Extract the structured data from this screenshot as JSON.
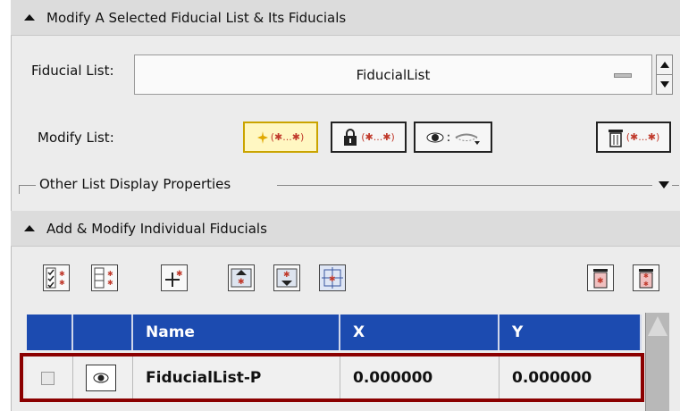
{
  "section1": {
    "title": "Modify A Selected Fiducial List & Its Fiducials",
    "fiducial_list_label": "Fiducial List:",
    "fiducial_list_value": "FiducialList",
    "modify_list_label": "Modify List:",
    "toolbar": [
      {
        "name": "visibility-toggle-button",
        "text": "(✱...✱)"
      },
      {
        "name": "lock-toggle-button",
        "text": "(✱...✱)"
      },
      {
        "name": "eye-visibility-menu-button",
        "text": ":"
      },
      {
        "name": "delete-list-button",
        "text": "(✱...✱)"
      }
    ],
    "other_props_label": "Other List Display Properties"
  },
  "section2": {
    "title": "Add & Modify Individual Fiducials"
  },
  "table": {
    "headers": [
      "",
      "",
      "Name",
      "X",
      "Y"
    ],
    "rows": [
      {
        "name": "FiducialList-P",
        "x": "0.000000",
        "y": "0.000000"
      }
    ]
  },
  "colors": {
    "header_blue": "#1c4bb0",
    "highlight_red": "#8b0000",
    "panel_gray": "#ececec"
  },
  "icons": [
    "select-all-icon",
    "deselect-all-icon",
    "add-fiducial-icon",
    "move-up-icon",
    "move-down-icon",
    "crosshair-icon",
    "delete-selected-icon",
    "delete-all-icon"
  ]
}
